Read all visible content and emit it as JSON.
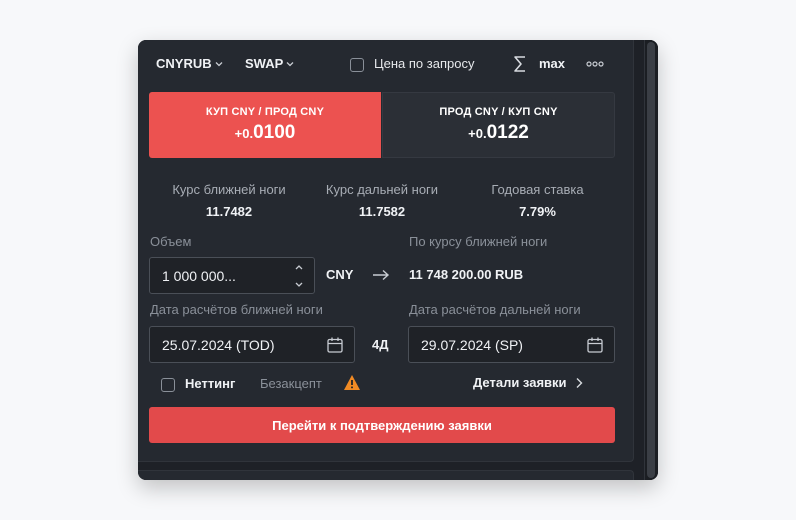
{
  "toolbar": {
    "instrument": "CNYRUB",
    "type": "SWAP",
    "price_on_request_label": "Цена по запросу",
    "max_label": "max"
  },
  "sides": {
    "buy": {
      "title": "КУП CNY / ПРОД CNY",
      "price_prefix": "+0.",
      "price_main": "0100"
    },
    "sell": {
      "title": "ПРОД CNY / КУП CNY",
      "price_prefix": "+0.",
      "price_main": "0122"
    }
  },
  "rates": [
    {
      "label": "Курс ближней ноги",
      "value": "11.7482"
    },
    {
      "label": "Курс дальней ноги",
      "value": "11.7582"
    },
    {
      "label": "Годовая ставка",
      "value": "7.79%"
    }
  ],
  "volume": {
    "label": "Объем",
    "value": "1 000 000...",
    "currency": "CNY"
  },
  "near_leg_result": {
    "label": "По курсу ближней ноги",
    "value": "11 748 200.00 RUB"
  },
  "near_date": {
    "label": "Дата расчётов ближней ноги",
    "value": "25.07.2024 (TOD)"
  },
  "term": "4Д",
  "far_date": {
    "label": "Дата расчётов дальней ноги",
    "value": "29.07.2024 (SP)"
  },
  "netting_label": "Неттинг",
  "no_accept_label": "Безакцепт",
  "order_details_label": "Детали заявки",
  "confirm_button": "Перейти к подтверждению заявки",
  "colors": {
    "buy_side": "#ec5250",
    "confirm": "#e24a4b",
    "warning": "#f08a24",
    "panel": "#252930"
  }
}
